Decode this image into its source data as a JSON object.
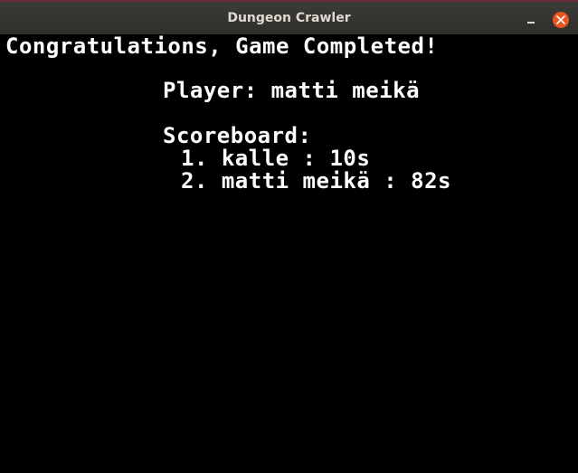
{
  "window": {
    "title": "Dungeon Crawler",
    "controls": {
      "minimize_icon": "minimize-icon",
      "close_icon": "close-icon",
      "close_color": "#e95420"
    }
  },
  "game": {
    "headline": "Congratulations, Game Completed!",
    "player_line": "Player: matti meikä",
    "scoreboard_heading": "Scoreboard:",
    "scoreboard": [
      {
        "rank": "1.",
        "name": "kalle",
        "time": "10s",
        "text": "1. kalle : 10s"
      },
      {
        "rank": "2.",
        "name": "matti meikä",
        "time": "82s",
        "text": "2. matti meikä : 82s"
      }
    ],
    "colors": {
      "background": "#000000",
      "text": "#ffffff"
    }
  }
}
